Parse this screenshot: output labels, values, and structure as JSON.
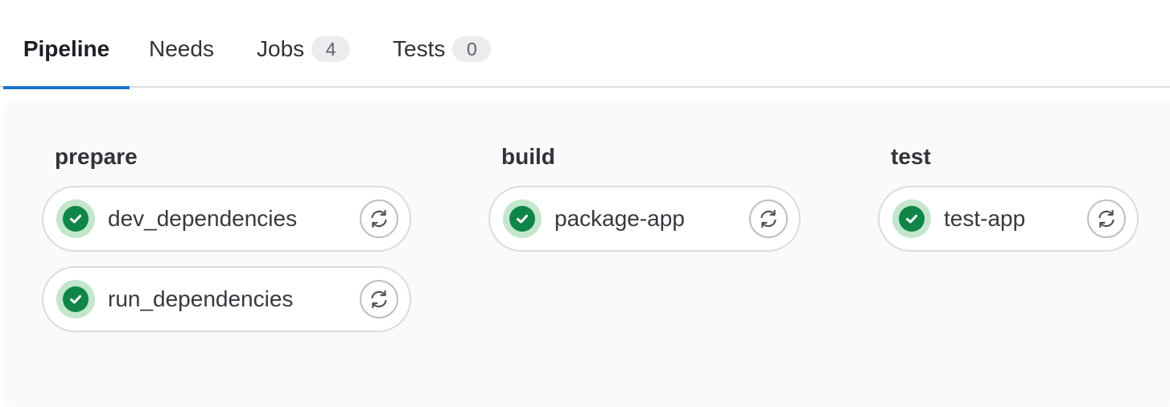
{
  "tabs": [
    {
      "label": "Pipeline",
      "active": true
    },
    {
      "label": "Needs",
      "active": false
    },
    {
      "label": "Jobs",
      "count": "4",
      "active": false
    },
    {
      "label": "Tests",
      "count": "0",
      "active": false
    }
  ],
  "stages": [
    {
      "title": "prepare",
      "jobs": [
        {
          "name": "dev_dependencies",
          "status": "success",
          "status_icon": "check-circle-icon",
          "action_icon": "retry-icon"
        },
        {
          "name": "run_dependencies",
          "status": "success",
          "status_icon": "check-circle-icon",
          "action_icon": "retry-icon"
        }
      ]
    },
    {
      "title": "build",
      "jobs": [
        {
          "name": "package-app",
          "status": "success",
          "status_icon": "check-circle-icon",
          "action_icon": "retry-icon"
        }
      ]
    },
    {
      "title": "test",
      "jobs": [
        {
          "name": "test-app",
          "status": "success",
          "status_icon": "check-circle-icon",
          "action_icon": "retry-icon"
        }
      ]
    }
  ],
  "colors": {
    "active_tab_underline": "#1f75cb",
    "success": "#108548",
    "success_ring": "#c3e6cd",
    "graph_background": "#fafafb"
  }
}
